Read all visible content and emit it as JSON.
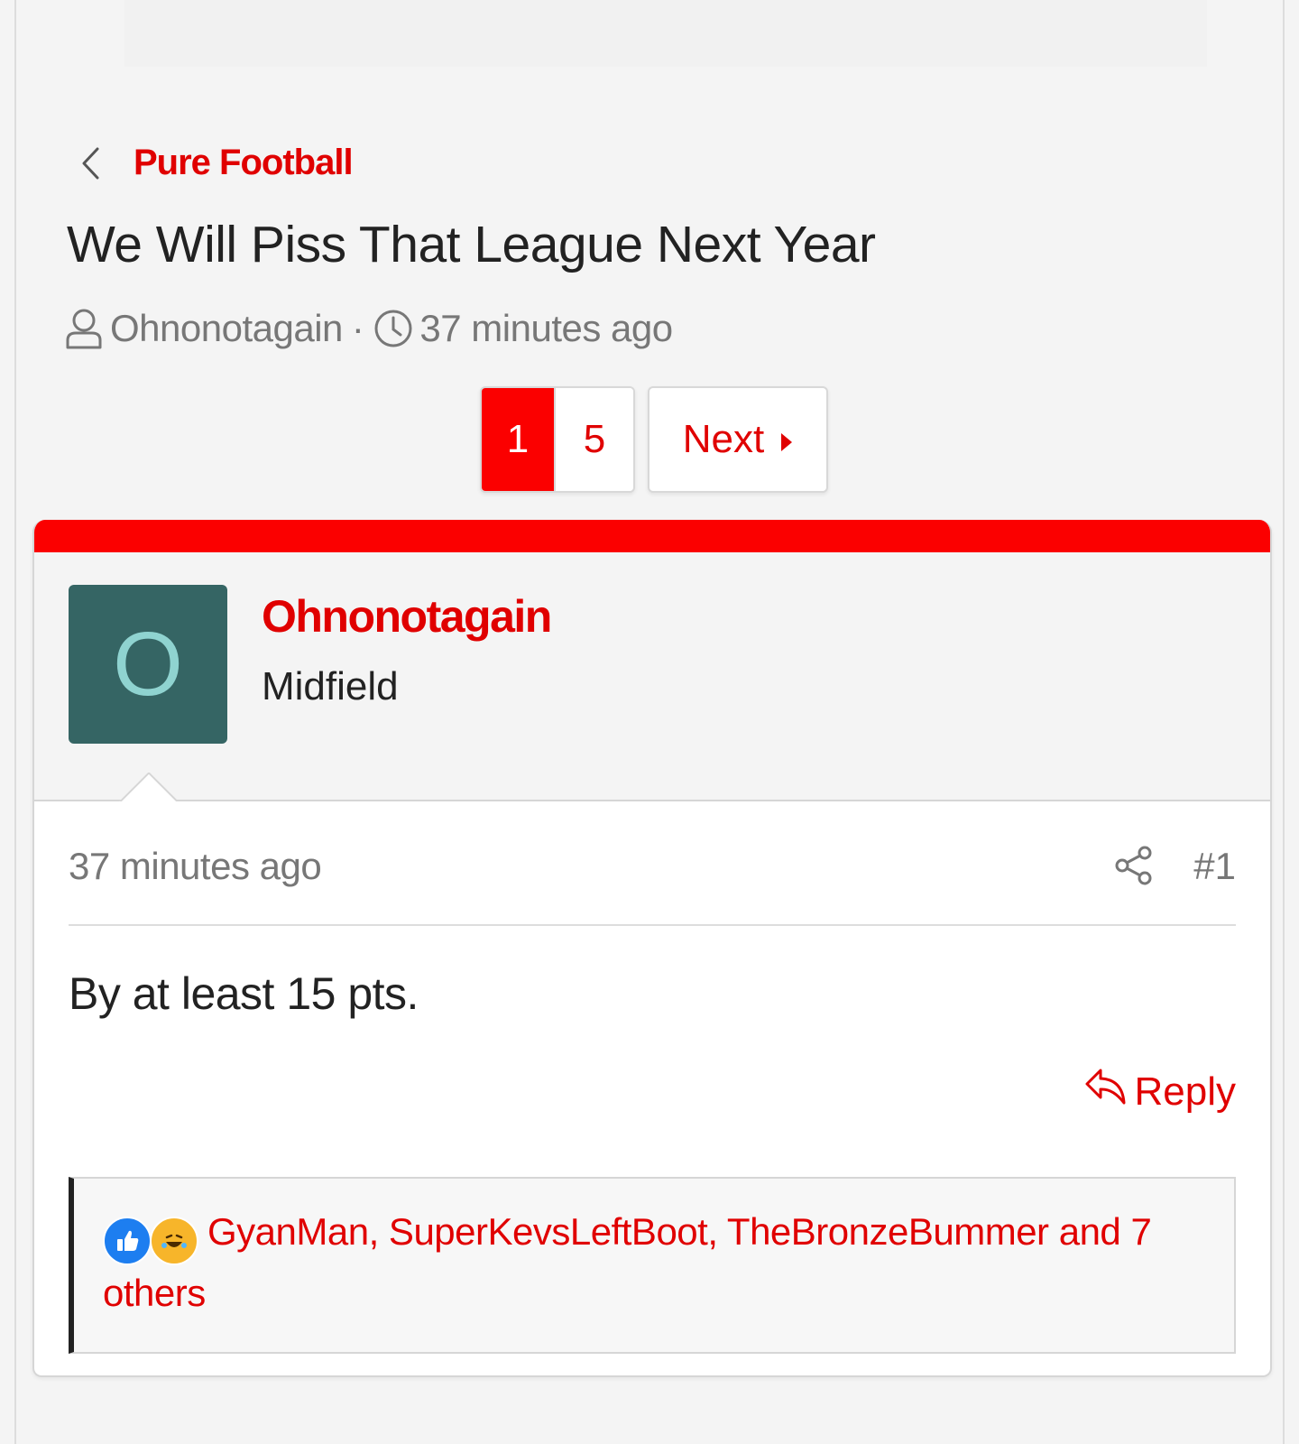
{
  "breadcrumb": {
    "forum_label": "Pure Football"
  },
  "thread": {
    "title": "We Will Piss That League Next Year",
    "author": "Ohnonotagain",
    "separator": "·",
    "time": "37 minutes ago"
  },
  "pagination": {
    "current_page": "1",
    "last_page": "5",
    "next_label": "Next"
  },
  "post": {
    "avatar_letter": "O",
    "username": "Ohnonotagain",
    "user_title": "Midfield",
    "time": "37 minutes ago",
    "number": "#1",
    "content": "By at least 15 pts.",
    "reply_label": "Reply",
    "reactions_text": "GyanMan, SuperKevsLeftBoot, TheBronzeBummer and 7 others"
  },
  "colors": {
    "accent": "#e00000",
    "topbar_red": "#fb0000",
    "avatar_bg": "#356564",
    "avatar_letter": "#8fd3d0"
  },
  "icons": {
    "back": "chevron-left-icon",
    "author": "user-icon",
    "time": "clock-icon",
    "next": "caret-right-icon",
    "share": "share-icon",
    "reply": "reply-icon",
    "reaction_like": "like-icon",
    "reaction_haha": "haha-icon"
  }
}
